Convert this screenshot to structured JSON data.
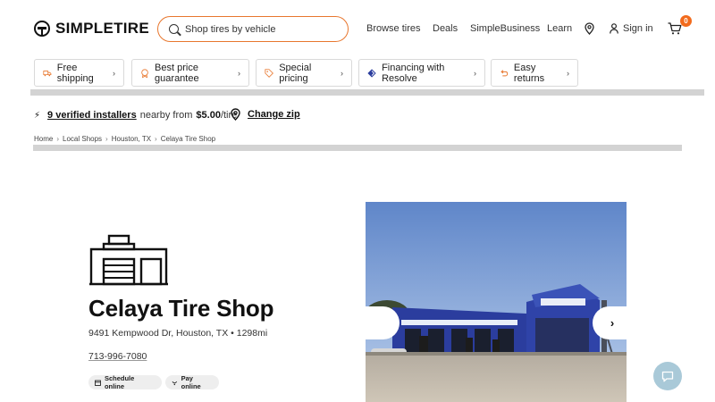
{
  "header": {
    "logo_text": "SIMPLETIRE",
    "search_placeholder": "Shop tires by vehicle",
    "nav": {
      "browse": "Browse tires",
      "deals": "Deals",
      "business": "SimpleBusiness",
      "learn": "Learn"
    },
    "sign_in": "Sign in",
    "cart_count": "0"
  },
  "promos": [
    {
      "label": "Free shipping",
      "icon": "truck-icon"
    },
    {
      "label": "Best price guarantee",
      "icon": "badge-icon"
    },
    {
      "label": "Special pricing",
      "icon": "tag-icon"
    },
    {
      "label": "Financing with Resolve",
      "icon": "resolve-logo-icon"
    },
    {
      "label": "Easy returns",
      "icon": "return-arrow-icon"
    }
  ],
  "installers": {
    "count_text": "9 verified installers",
    "middle_text": "nearby from",
    "price": "$5.00",
    "unit": "/tire",
    "change_zip": "Change zip"
  },
  "breadcrumb": [
    "Home",
    "Local Shops",
    "Houston, TX",
    "Celaya Tire Shop"
  ],
  "shop": {
    "name": "Celaya Tire Shop",
    "address": "9491 Kempwood Dr, Houston, TX • 1298mi",
    "phone": "713-996-7080",
    "schedule_label": "Schedule online",
    "pay_label": "Pay online"
  },
  "colors": {
    "accent_orange": "#e8772e",
    "badge_orange": "#f26b1d",
    "chat_blue": "#a9c9d8",
    "building_blue": "#2b3d9e"
  }
}
